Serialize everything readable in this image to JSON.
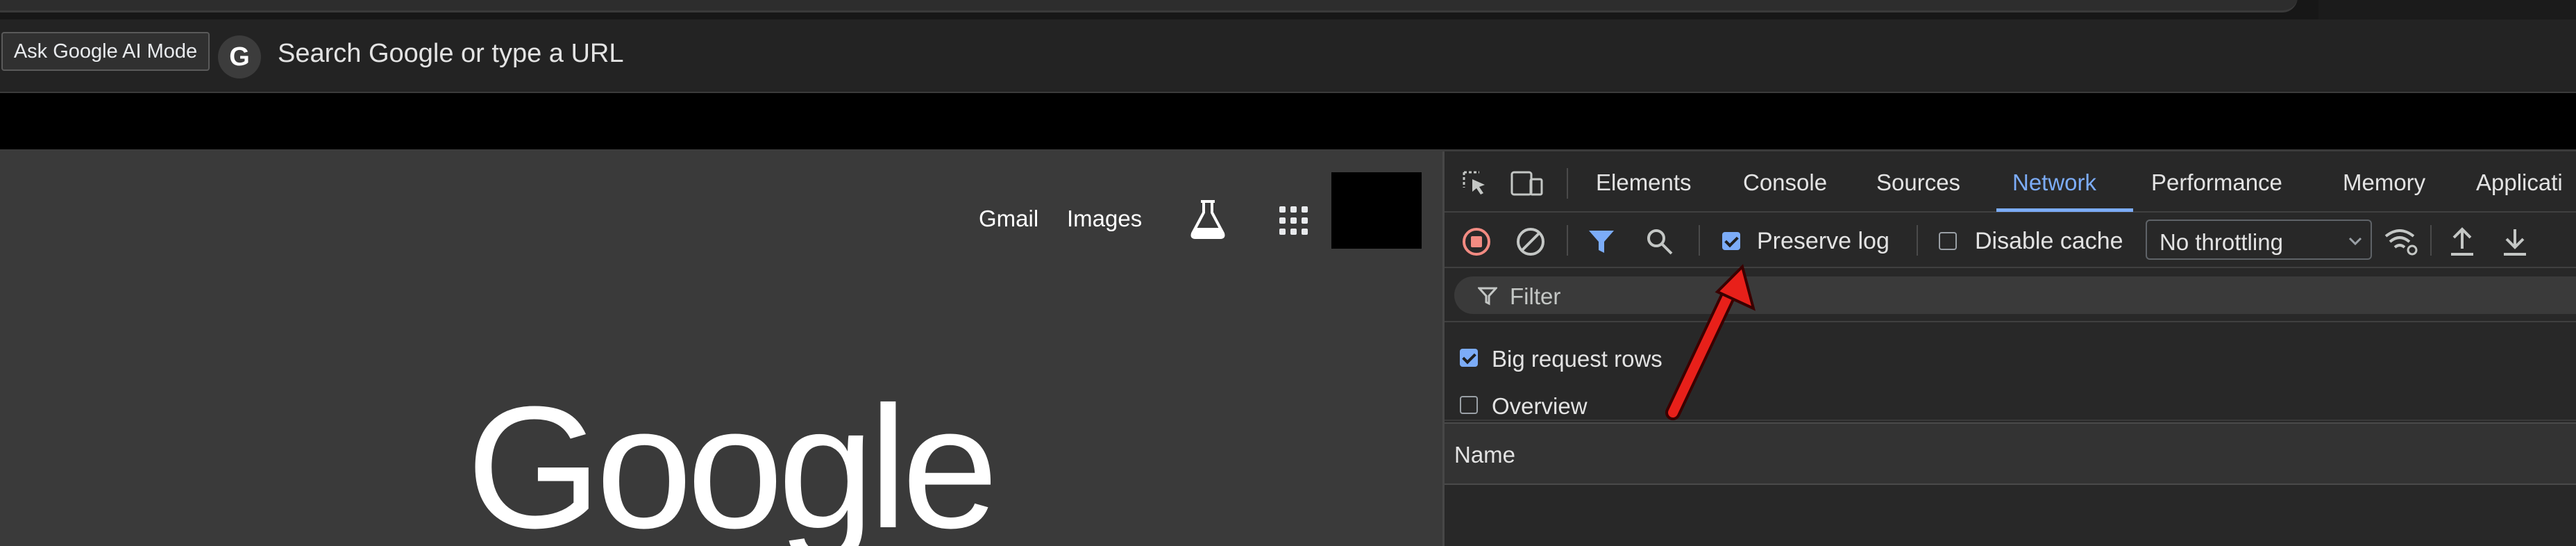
{
  "browser": {
    "ai_mode_label": "Ask Google AI Mode",
    "omnibox_badge": "G",
    "omnibox_placeholder": "Search Google or type a URL"
  },
  "page": {
    "links": {
      "gmail": "Gmail",
      "images": "Images"
    },
    "logo_text": "Google"
  },
  "devtools": {
    "tabs": [
      {
        "label": "Elements"
      },
      {
        "label": "Console"
      },
      {
        "label": "Sources"
      },
      {
        "label": "Network"
      },
      {
        "label": "Performance"
      },
      {
        "label": "Memory"
      },
      {
        "label": "Applicati"
      }
    ],
    "active_tab": "Network",
    "accent_color": "#7cacf8",
    "record_color": "#f28b82",
    "controls": {
      "preserve_log_label": "Preserve log",
      "preserve_log_checked": true,
      "disable_cache_label": "Disable cache",
      "disable_cache_checked": false,
      "throttling_value": "No throttling"
    },
    "filter_placeholder": "Filter",
    "settings": {
      "big_request_rows_label": "Big request rows",
      "big_request_rows_checked": true,
      "overview_label": "Overview",
      "overview_checked": false
    },
    "table": {
      "name_header": "Name"
    }
  },
  "annotation": {
    "arrow_color": "#e8201a"
  }
}
